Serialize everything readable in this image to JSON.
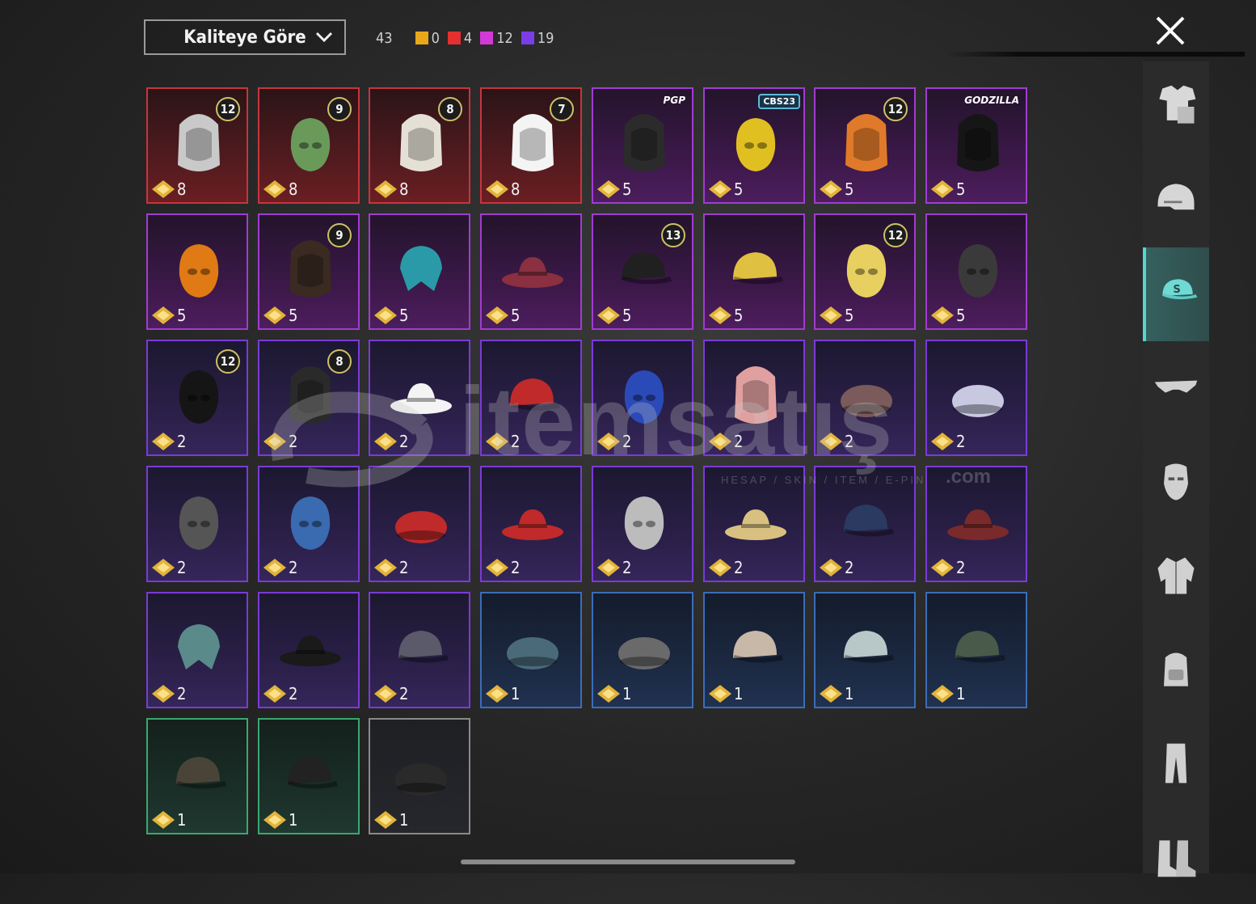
{
  "sort": {
    "label": "Kaliteye Göre"
  },
  "counts": {
    "total": "43",
    "groups": [
      {
        "color": "#e8a81a",
        "value": "0"
      },
      {
        "color": "#e43030",
        "value": "4"
      },
      {
        "color": "#d23ad6",
        "value": "12"
      },
      {
        "color": "#7a3ee6",
        "value": "19"
      }
    ]
  },
  "sidebar": {
    "categories": [
      {
        "icon": "outfit-icon",
        "active": false
      },
      {
        "icon": "helmet-icon",
        "active": false
      },
      {
        "icon": "cap-icon",
        "active": true
      },
      {
        "icon": "glasses-icon",
        "active": false
      },
      {
        "icon": "mask-icon",
        "active": false
      },
      {
        "icon": "jacket-icon",
        "active": false
      },
      {
        "icon": "backpack-icon",
        "active": false
      },
      {
        "icon": "pants-icon",
        "active": false
      },
      {
        "icon": "boots-icon",
        "active": false
      }
    ]
  },
  "watermark": {
    "text": "itemsatış",
    "sub": "HESAP / SKIN / ITEM / E-PIN",
    "com": ".com"
  },
  "items": [
    {
      "rarity": "red",
      "points": "8",
      "badge": "12",
      "icon": "silver-hair-bun-icon"
    },
    {
      "rarity": "red",
      "points": "8",
      "badge": "9",
      "icon": "green-head-icon"
    },
    {
      "rarity": "red",
      "points": "8",
      "badge": "8",
      "icon": "white-short-hair-icon"
    },
    {
      "rarity": "red",
      "points": "8",
      "badge": "7",
      "icon": "white-long-hair-icon"
    },
    {
      "rarity": "purple",
      "points": "5",
      "tag": "PGP",
      "icon": "dark-hair-bun-icon"
    },
    {
      "rarity": "purple",
      "points": "5",
      "tag": "CBS23",
      "icon": "cat-headphones-icon"
    },
    {
      "rarity": "purple",
      "points": "5",
      "badge": "12",
      "icon": "orange-pigtails-icon"
    },
    {
      "rarity": "purple",
      "points": "5",
      "tag": "GODZILLA",
      "icon": "godzilla-hair-icon"
    },
    {
      "rarity": "purple",
      "points": "5",
      "icon": "pumpkin-head-icon"
    },
    {
      "rarity": "purple",
      "points": "5",
      "badge": "9",
      "icon": "long-brown-hair-icon"
    },
    {
      "rarity": "purple",
      "points": "5",
      "icon": "elf-bandana-icon"
    },
    {
      "rarity": "purple",
      "points": "5",
      "icon": "pirate-hat-icon"
    },
    {
      "rarity": "purple",
      "points": "5",
      "badge": "13",
      "icon": "devil-horn-cap-icon"
    },
    {
      "rarity": "purple",
      "points": "5",
      "icon": "fish-cap-icon"
    },
    {
      "rarity": "purple",
      "points": "5",
      "badge": "12",
      "icon": "yellow-can-head-icon"
    },
    {
      "rarity": "purple",
      "points": "5",
      "icon": "cat-mask-icon"
    },
    {
      "rarity": "violet",
      "points": "2",
      "badge": "12",
      "icon": "bunny-helmet-icon"
    },
    {
      "rarity": "violet",
      "points": "2",
      "badge": "8",
      "icon": "alien-hair-icon"
    },
    {
      "rarity": "violet",
      "points": "2",
      "icon": "white-sun-hat-icon"
    },
    {
      "rarity": "violet",
      "points": "2",
      "icon": "red-gold-cap-icon"
    },
    {
      "rarity": "violet",
      "points": "2",
      "icon": "cricket-helmet-icon"
    },
    {
      "rarity": "violet",
      "points": "2",
      "icon": "pink-braids-icon"
    },
    {
      "rarity": "violet",
      "points": "2",
      "icon": "goggles-beanie-icon"
    },
    {
      "rarity": "violet",
      "points": "2",
      "icon": "winter-beanie-icon"
    },
    {
      "rarity": "violet",
      "points": "2",
      "icon": "luchador-mask-icon"
    },
    {
      "rarity": "violet",
      "points": "2",
      "icon": "shark-hood-icon"
    },
    {
      "rarity": "violet",
      "points": "2",
      "icon": "red-beret-icon"
    },
    {
      "rarity": "violet",
      "points": "2",
      "icon": "red-fedora-icon"
    },
    {
      "rarity": "violet",
      "points": "2",
      "icon": "shark-head-icon"
    },
    {
      "rarity": "violet",
      "points": "2",
      "icon": "sundae-hat-icon"
    },
    {
      "rarity": "violet",
      "points": "2",
      "icon": "blue-cap-icon"
    },
    {
      "rarity": "violet",
      "points": "2",
      "icon": "maroon-fedora-icon"
    },
    {
      "rarity": "violet",
      "points": "2",
      "icon": "plaid-bandana-icon"
    },
    {
      "rarity": "violet",
      "points": "2",
      "icon": "bucket-hat-icon"
    },
    {
      "rarity": "violet",
      "points": "2",
      "icon": "aviator-cap-icon"
    },
    {
      "rarity": "blue",
      "points": "1",
      "icon": "blue-beret-icon"
    },
    {
      "rarity": "blue",
      "points": "1",
      "icon": "grey-beret-icon"
    },
    {
      "rarity": "blue",
      "points": "1",
      "icon": "baseball-cap-red-icon"
    },
    {
      "rarity": "blue",
      "points": "1",
      "icon": "baseball-cap-blue-icon"
    },
    {
      "rarity": "blue",
      "points": "1",
      "icon": "camo-headset-cap-icon"
    },
    {
      "rarity": "green",
      "points": "1",
      "icon": "patrol-cap-icon"
    },
    {
      "rarity": "green",
      "points": "1",
      "icon": "black-s-cap-icon"
    },
    {
      "rarity": "grey",
      "points": "1",
      "icon": "black-beanie-icon"
    }
  ]
}
